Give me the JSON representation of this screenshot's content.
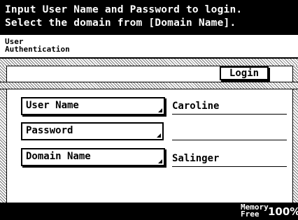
{
  "header": {
    "line1": "Input User Name and Password to login.",
    "line2": "Select the domain from [Domain Name]."
  },
  "breadcrumb": {
    "line1": "User",
    "line2": "Authentication"
  },
  "login_button": "Login",
  "fields": {
    "user_name": {
      "label": "User Name",
      "value": "Caroline"
    },
    "password": {
      "label": "Password",
      "value": ""
    },
    "domain_name": {
      "label": "Domain Name",
      "value": "Salinger"
    }
  },
  "footer": {
    "memory_label_line1": "Memory",
    "memory_label_line2": "Free",
    "memory_value": "100%"
  }
}
